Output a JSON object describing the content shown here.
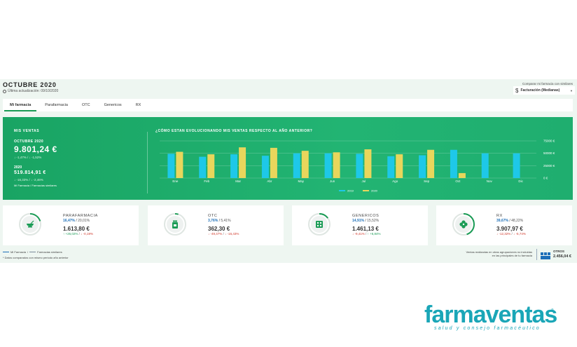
{
  "header": {
    "title": "OCTUBRE 2020",
    "last_update": "Última actualización: 09/10/2020",
    "compare_label": "Comparar mi farmacia con similares",
    "compare_select": "Facturación (Medianas)",
    "icons": {
      "clock": "clock-icon",
      "currency": "dollar-icon",
      "dropdown": "chevron-down-icon"
    }
  },
  "tabs": [
    {
      "label": "Mi farmacia",
      "active": true
    },
    {
      "label": "Parafarmacia"
    },
    {
      "label": "OTC"
    },
    {
      "label": "Genericos"
    },
    {
      "label": "RX"
    }
  ],
  "summary": {
    "section_label": "MIS VENTAS",
    "current_month": "OCTUBRE 2020",
    "current_value": "9.801,24 €",
    "current_compare": "↓ -1,47% / ↓ -1,52%",
    "year_label": "2020",
    "year_value": "519.814,91 €",
    "year_compare": "↓ -16,33% / ↓ -2,46%",
    "legend": "Mi Farmacia / Farmacias similares"
  },
  "chart_data": {
    "type": "bar",
    "title": "¿CÓMO ESTAN EVOLUCIONANDO MIS VENTAS RESPECTO AL AÑO ANTERIOR?",
    "categories": [
      "Ene",
      "Feb",
      "Mar",
      "Abr",
      "May",
      "Jun",
      "Jul",
      "Ago",
      "Sep",
      "Oct",
      "Nov",
      "Dic"
    ],
    "series": [
      {
        "name": "2019",
        "color": "#1ec8e8",
        "values": [
          49000,
          43000,
          48000,
          45000,
          50000,
          50000,
          49000,
          44000,
          46000,
          57000,
          50000,
          50000
        ]
      },
      {
        "name": "2020",
        "color": "#e8d65c",
        "values": [
          53000,
          48000,
          62000,
          61000,
          55000,
          52000,
          58000,
          48000,
          57000,
          10000,
          null,
          null
        ]
      }
    ],
    "y_ticks": [
      "75000 €",
      "50000 €",
      "25000 €",
      "0 €"
    ],
    "ylim": [
      0,
      75000
    ],
    "grid": true,
    "legend_position": "bottom"
  },
  "cards": [
    {
      "name": "PARAFARMACIA",
      "pct_a": "16,47%",
      "pct_b": "20,01%",
      "value": "1.613,80 €",
      "cmp_a": "+26,02%",
      "cmp_b": "-0,19%",
      "cmp_a_dir": "up",
      "cmp_b_dir": "down",
      "icon": "mortar-pestle-icon",
      "ring": 0.2
    },
    {
      "name": "OTC",
      "pct_a": "3,76%",
      "pct_b": "5,41%",
      "value": "362,30 €",
      "cmp_a": "-49,47%",
      "cmp_b": "-16,43%",
      "cmp_a_dir": "down",
      "cmp_b_dir": "down",
      "icon": "medicine-bottle-icon",
      "ring": 0.05
    },
    {
      "name": "GENERICOS",
      "pct_a": "14,91%",
      "pct_b": "15,52%",
      "value": "1.461,13 €",
      "cmp_a": "-9,41%",
      "cmp_b": "+6,84%",
      "cmp_a_dir": "down",
      "cmp_b_dir": "up",
      "icon": "pill-blister-icon",
      "ring": 0.15
    },
    {
      "name": "RX",
      "pct_a": "39,67%",
      "pct_b": "48,22%",
      "value": "3.907,97 €",
      "cmp_a": "-12,32%",
      "cmp_b": "-5,74%",
      "cmp_a_dir": "down",
      "cmp_b_dir": "down",
      "icon": "rx-cross-icon",
      "ring": 0.45
    }
  ],
  "footer": {
    "legend_a": "Mi Farmacia",
    "legend_b": "Farmacias similares",
    "legend_a_color": "#1d6fb8",
    "legend_b_color": "#7a8a9a",
    "note": "* Datos comparados con mismo periodo año anterior",
    "right_note": "Ventas realizadas en otras agrupaciones no incluidas en las principales de tu farmacia",
    "other_label": "OTROS",
    "other_value": "2.456,04 €"
  },
  "brand": {
    "logo": "farmaventas",
    "reg": "®",
    "tagline": "salud y consejo farmacéutico",
    "color": "#1aa6b7"
  }
}
